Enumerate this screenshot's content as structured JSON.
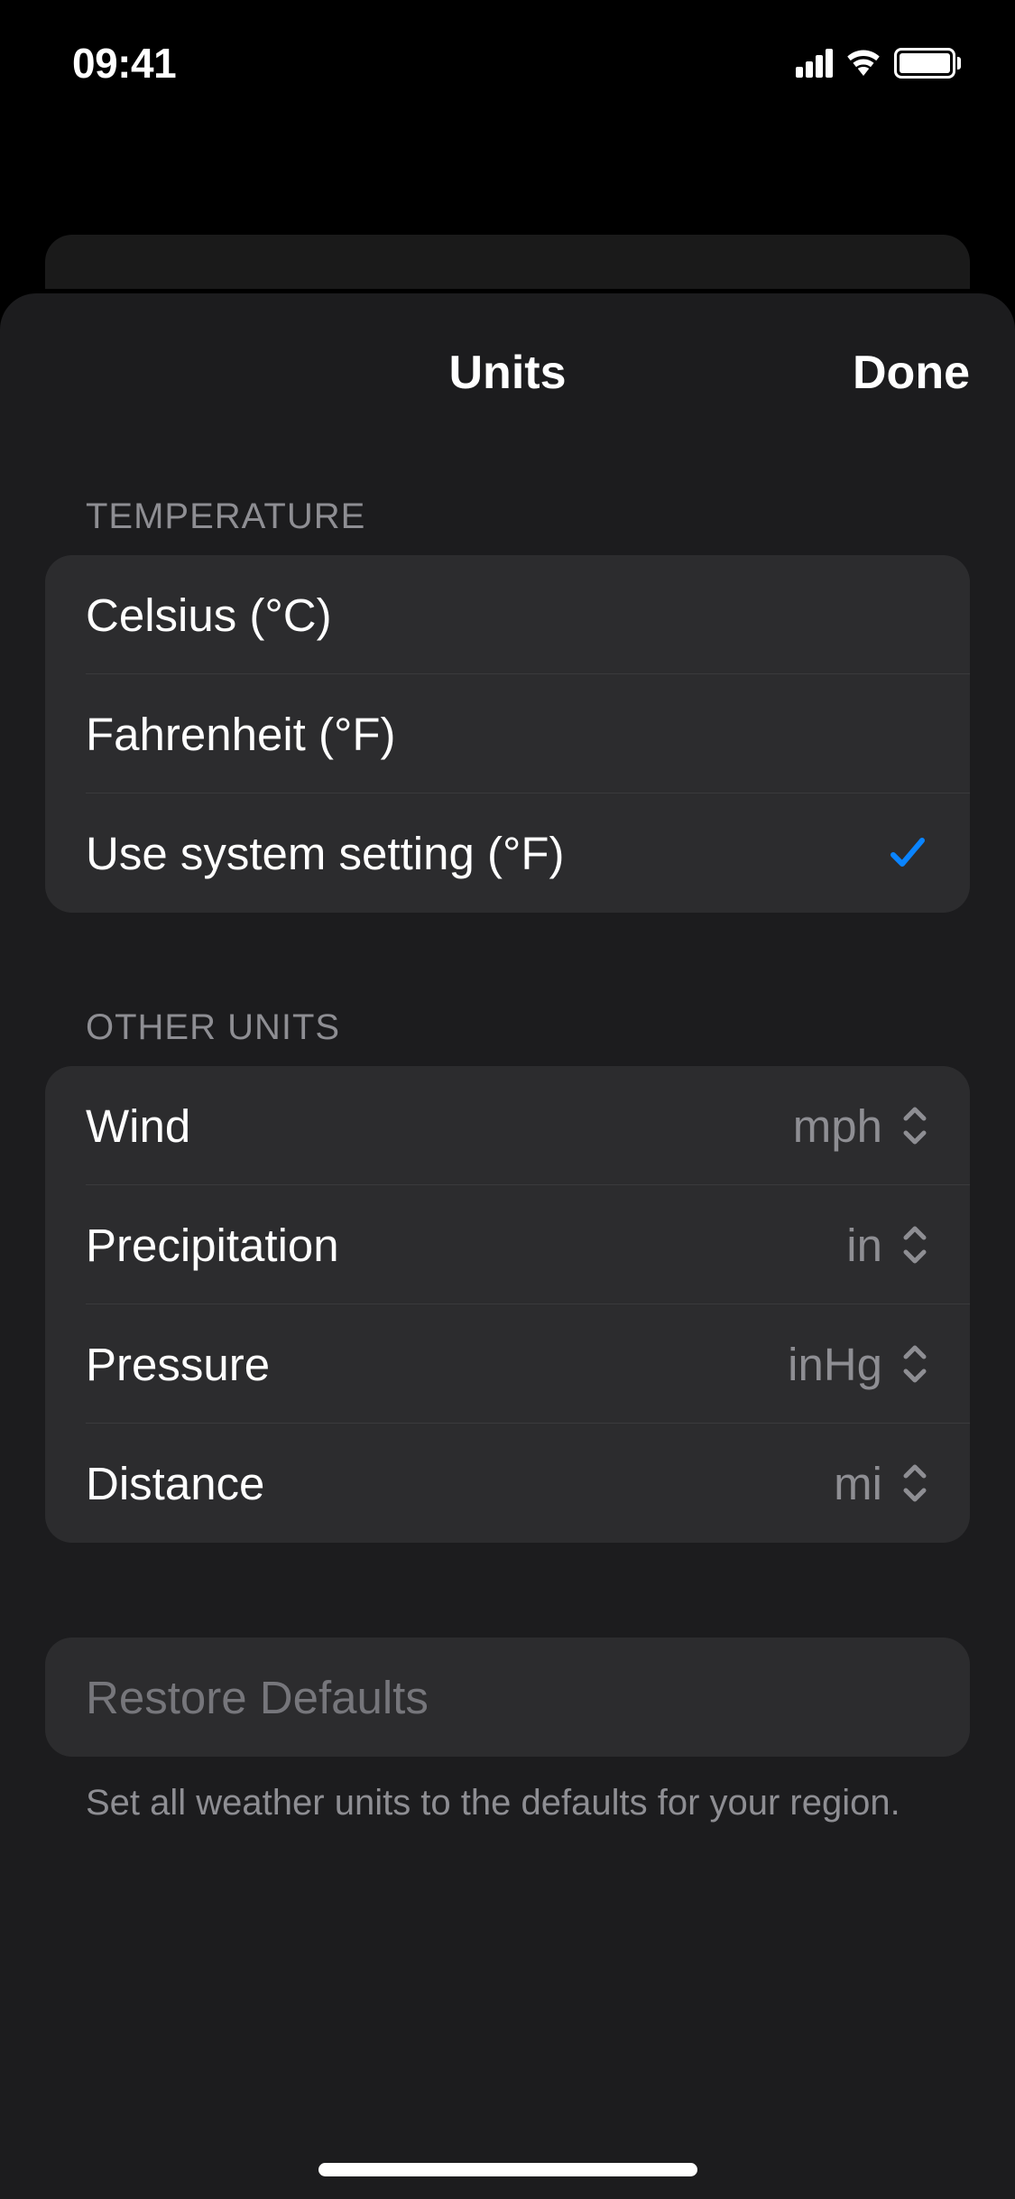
{
  "status_bar": {
    "time": "09:41"
  },
  "sheet": {
    "title": "Units",
    "done_label": "Done"
  },
  "temperature": {
    "header": "TEMPERATURE",
    "options": [
      {
        "label": "Celsius (°C)",
        "selected": false
      },
      {
        "label": "Fahrenheit (°F)",
        "selected": false
      },
      {
        "label": "Use system setting (°F)",
        "selected": true
      }
    ]
  },
  "other_units": {
    "header": "OTHER UNITS",
    "items": [
      {
        "label": "Wind",
        "value": "mph"
      },
      {
        "label": "Precipitation",
        "value": "in"
      },
      {
        "label": "Pressure",
        "value": "inHg"
      },
      {
        "label": "Distance",
        "value": "mi"
      }
    ]
  },
  "restore": {
    "label": "Restore Defaults",
    "footer": "Set all weather units to the defaults for your region."
  },
  "colors": {
    "accent_blue": "#0a84ff"
  }
}
